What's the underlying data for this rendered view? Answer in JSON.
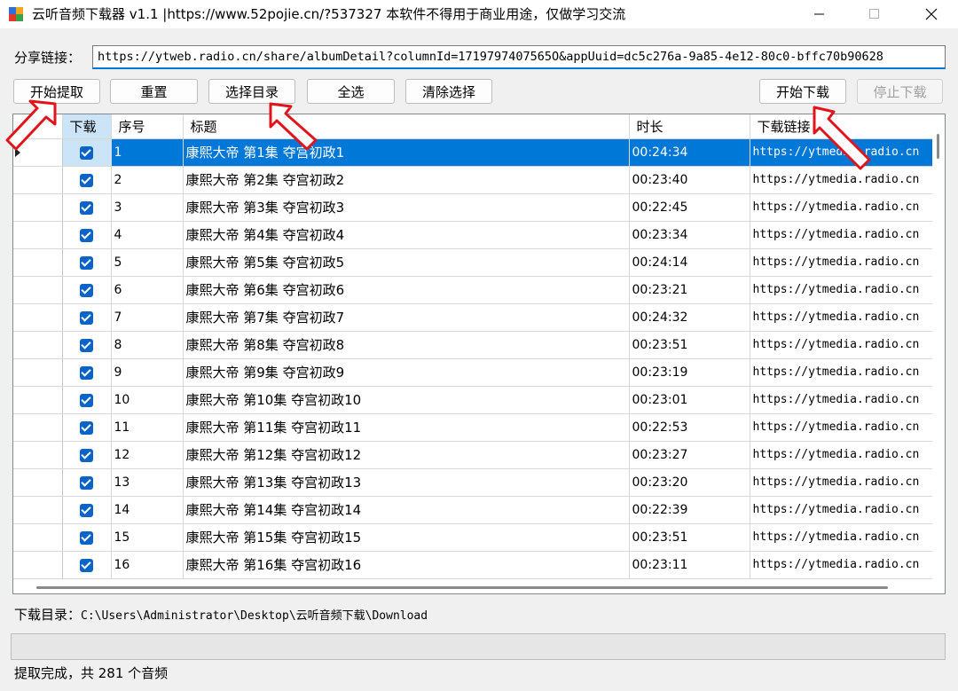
{
  "window": {
    "title": "云听音频下载器 v1.1 |https://www.52pojie.cn/?537327 本软件不得用于商业用途，仅做学习交流"
  },
  "share": {
    "label": "分享链接：",
    "value": "https://ytweb.radio.cn/share/albumDetail?columnId=1719797407565O&appUuid=dc5c276a-9a85-4e12-80c0-bffc70b90628"
  },
  "toolbar": {
    "start_extract": "开始提取",
    "reset": "重置",
    "choose_dir": "选择目录",
    "select_all": "全选",
    "clear_selection": "清除选择",
    "start_download": "开始下载",
    "stop_download": "停止下载"
  },
  "grid": {
    "columns": [
      "下载",
      "序号",
      "标题",
      "时长",
      "下载链接"
    ],
    "rows": [
      {
        "checked": true,
        "index": "1",
        "title": "康熙大帝 第1集 夺宫初政1",
        "duration": "00:24:34",
        "link": "https://ytmedia.radio.cn"
      },
      {
        "checked": true,
        "index": "2",
        "title": "康熙大帝 第2集 夺宫初政2",
        "duration": "00:23:40",
        "link": "https://ytmedia.radio.cn"
      },
      {
        "checked": true,
        "index": "3",
        "title": "康熙大帝 第3集 夺宫初政3",
        "duration": "00:22:45",
        "link": "https://ytmedia.radio.cn"
      },
      {
        "checked": true,
        "index": "4",
        "title": "康熙大帝 第4集 夺宫初政4",
        "duration": "00:23:34",
        "link": "https://ytmedia.radio.cn"
      },
      {
        "checked": true,
        "index": "5",
        "title": "康熙大帝 第5集 夺宫初政5",
        "duration": "00:24:14",
        "link": "https://ytmedia.radio.cn"
      },
      {
        "checked": true,
        "index": "6",
        "title": "康熙大帝 第6集 夺宫初政6",
        "duration": "00:23:21",
        "link": "https://ytmedia.radio.cn"
      },
      {
        "checked": true,
        "index": "7",
        "title": "康熙大帝 第7集 夺宫初政7",
        "duration": "00:24:32",
        "link": "https://ytmedia.radio.cn"
      },
      {
        "checked": true,
        "index": "8",
        "title": "康熙大帝 第8集 夺宫初政8",
        "duration": "00:23:51",
        "link": "https://ytmedia.radio.cn"
      },
      {
        "checked": true,
        "index": "9",
        "title": "康熙大帝 第9集 夺宫初政9",
        "duration": "00:23:19",
        "link": "https://ytmedia.radio.cn"
      },
      {
        "checked": true,
        "index": "10",
        "title": "康熙大帝 第10集 夺宫初政10",
        "duration": "00:23:01",
        "link": "https://ytmedia.radio.cn"
      },
      {
        "checked": true,
        "index": "11",
        "title": "康熙大帝 第11集 夺宫初政11",
        "duration": "00:22:53",
        "link": "https://ytmedia.radio.cn"
      },
      {
        "checked": true,
        "index": "12",
        "title": "康熙大帝 第12集 夺宫初政12",
        "duration": "00:23:27",
        "link": "https://ytmedia.radio.cn"
      },
      {
        "checked": true,
        "index": "13",
        "title": "康熙大帝 第13集 夺宫初政13",
        "duration": "00:23:20",
        "link": "https://ytmedia.radio.cn"
      },
      {
        "checked": true,
        "index": "14",
        "title": "康熙大帝 第14集 夺宫初政14",
        "duration": "00:22:39",
        "link": "https://ytmedia.radio.cn"
      },
      {
        "checked": true,
        "index": "15",
        "title": "康熙大帝 第15集 夺宫初政15",
        "duration": "00:23:51",
        "link": "https://ytmedia.radio.cn"
      },
      {
        "checked": true,
        "index": "16",
        "title": "康熙大帝 第16集 夺宫初政16",
        "duration": "00:23:11",
        "link": "https://ytmedia.radio.cn"
      }
    ]
  },
  "download_dir": {
    "label": "下载目录：",
    "path": "C:\\Users\\Administrator\\Desktop\\云听音频下载\\Download"
  },
  "progress": {
    "value": 0
  },
  "status": "提取完成，共 281 个音频",
  "colors": {
    "accent": "#0078d7",
    "annotation_arrow": "#e0151b",
    "checkbox": "#0a64c8"
  }
}
